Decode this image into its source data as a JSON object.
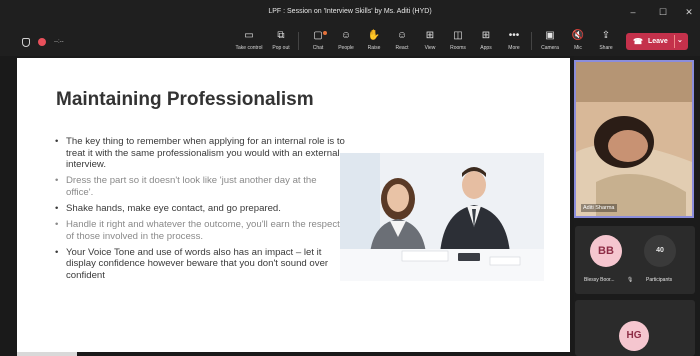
{
  "window": {
    "title": "LPF : Session on 'Interview Skills' by Ms. Aditi (HYD)",
    "minimize_icon": "minimize-icon",
    "maximize_icon": "maximize-icon",
    "close_icon": "close-icon"
  },
  "toolbar": {
    "timer": "--:--",
    "take_control": "Take control",
    "pop_out": "Pop out",
    "chat": "Chat",
    "people": "People",
    "raise": "Raise",
    "react": "React",
    "view": "View",
    "rooms": "Rooms",
    "apps": "Apps",
    "more": "More",
    "camera": "Camera",
    "mic": "Mic",
    "share": "Share",
    "leave": "Leave"
  },
  "slide": {
    "title": "Maintaining Professionalism",
    "bullets": [
      "The key thing to remember when applying for an internal role is to treat it with the same professionalism you would with an external interview.",
      "Dress the part so it doesn't look like 'just another day at the office'.",
      "Shake hands, make eye contact, and go prepared.",
      "Handle it right and whatever the outcome, you'll earn the respect of those involved in the process.",
      "Your Voice Tone and use of words also has an impact – let it display confidence however beware that you don't sound over confident"
    ]
  },
  "participants": {
    "video_name": "Aditi Sharma",
    "bb_initials": "BB",
    "bb_name": "Blessy Boor...",
    "count": "40",
    "count_label": "Participants",
    "hg_initials": "HG"
  },
  "colors": {
    "leave": "#c4314b",
    "accent": "#8b8ddb",
    "avatar_bg": "#f5c6cf"
  }
}
